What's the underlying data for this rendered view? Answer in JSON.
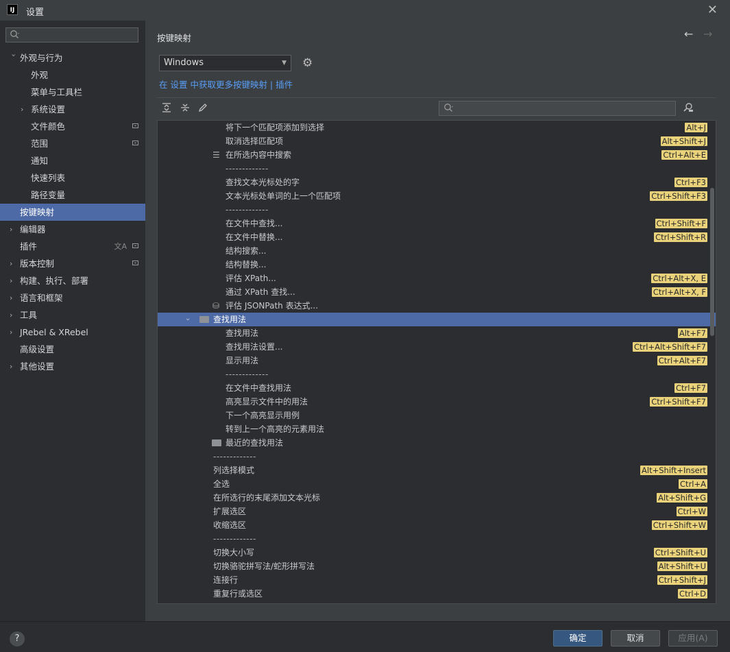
{
  "window": {
    "title": "设置",
    "logo": "IJ"
  },
  "sidebar": {
    "search_placeholder": "",
    "items": [
      {
        "label": "外观与行为",
        "indent": 1,
        "expanded": true,
        "chevron": true,
        "badge": false
      },
      {
        "label": "外观",
        "indent": 2
      },
      {
        "label": "菜单与工具栏",
        "indent": 2
      },
      {
        "label": "系统设置",
        "indent": 2,
        "chevron": true
      },
      {
        "label": "文件颜色",
        "indent": 2,
        "badge": true
      },
      {
        "label": "范围",
        "indent": 2,
        "badge": true
      },
      {
        "label": "通知",
        "indent": 2
      },
      {
        "label": "快速列表",
        "indent": 2
      },
      {
        "label": "路径变量",
        "indent": 2
      },
      {
        "label": "按键映射",
        "indent": 1,
        "selected": true
      },
      {
        "label": "编辑器",
        "indent": 1,
        "chevron": true
      },
      {
        "label": "插件",
        "indent": 1,
        "badge": true,
        "lang": true
      },
      {
        "label": "版本控制",
        "indent": 1,
        "chevron": true,
        "badge": true
      },
      {
        "label": "构建、执行、部署",
        "indent": 1,
        "chevron": true
      },
      {
        "label": "语言和框架",
        "indent": 1,
        "chevron": true
      },
      {
        "label": "工具",
        "indent": 1,
        "chevron": true
      },
      {
        "label": "JRebel & XRebel",
        "indent": 1,
        "chevron": true
      },
      {
        "label": "高级设置",
        "indent": 1
      },
      {
        "label": "其他设置",
        "indent": 1,
        "chevron": true
      }
    ]
  },
  "header": {
    "title": "按键映射"
  },
  "keymap": {
    "selected": "Windows",
    "link_prefix": "在 设置 中获取更多按键映射",
    "link_sep": " | ",
    "link_plugins": "插件"
  },
  "filter": {
    "placeholder": ""
  },
  "actions": [
    {
      "label": "将下一个匹配项添加到选择",
      "indent": 2,
      "shortcut": "Alt+J"
    },
    {
      "label": "取消选择匹配项",
      "indent": 2,
      "shortcut": "Alt+Shift+J"
    },
    {
      "label": "在所选内容中搜索",
      "indent": 2,
      "shortcut": "Ctrl+Alt+E",
      "icon": "search-in-selection-icon"
    },
    {
      "label": "-------------",
      "indent": 2,
      "sep": true
    },
    {
      "label": "查找文本光标处的字",
      "indent": 2,
      "shortcut": "Ctrl+F3"
    },
    {
      "label": "文本光标处单词的上一个匹配项",
      "indent": 2,
      "shortcut": "Ctrl+Shift+F3"
    },
    {
      "label": "-------------",
      "indent": 2,
      "sep": true
    },
    {
      "label": "在文件中查找...",
      "indent": 2,
      "shortcut": "Ctrl+Shift+F"
    },
    {
      "label": "在文件中替换...",
      "indent": 2,
      "shortcut": "Ctrl+Shift+R"
    },
    {
      "label": "结构搜索...",
      "indent": 2
    },
    {
      "label": "结构替换...",
      "indent": 2
    },
    {
      "label": "评估 XPath...",
      "indent": 2,
      "shortcut": "Ctrl+Alt+X, E"
    },
    {
      "label": "通过 XPath 查找...",
      "indent": 2,
      "shortcut": "Ctrl+Alt+X, F"
    },
    {
      "label": "评估 JSONPath 表达式...",
      "indent": 2,
      "icon": "jsonpath-icon"
    },
    {
      "label": "查找用法",
      "indent": 1,
      "group": true,
      "selected": true
    },
    {
      "label": "查找用法",
      "indent": 2,
      "shortcut": "Alt+F7"
    },
    {
      "label": "查找用法设置...",
      "indent": 2,
      "shortcut": "Ctrl+Alt+Shift+F7"
    },
    {
      "label": "显示用法",
      "indent": 2,
      "shortcut": "Ctrl+Alt+F7"
    },
    {
      "label": "-------------",
      "indent": 2,
      "sep": true
    },
    {
      "label": "在文件中查找用法",
      "indent": 2,
      "shortcut": "Ctrl+F7"
    },
    {
      "label": "高亮显示文件中的用法",
      "indent": 2,
      "shortcut": "Ctrl+Shift+F7"
    },
    {
      "label": "下一个高亮显示用例",
      "indent": 2
    },
    {
      "label": "转到上一个高亮的元素用法",
      "indent": 2
    },
    {
      "label": "最近的查找用法",
      "indent": 2,
      "folder": true
    },
    {
      "label": "-------------",
      "indent": 1,
      "sep": true
    },
    {
      "label": "列选择模式",
      "indent": 1,
      "shortcut": "Alt+Shift+Insert"
    },
    {
      "label": "全选",
      "indent": 1,
      "shortcut": "Ctrl+A"
    },
    {
      "label": "在所选行的末尾添加文本光标",
      "indent": 1,
      "shortcut": "Alt+Shift+G"
    },
    {
      "label": "扩展选区",
      "indent": 1,
      "shortcut": "Ctrl+W"
    },
    {
      "label": "收缩选区",
      "indent": 1,
      "shortcut": "Ctrl+Shift+W"
    },
    {
      "label": "-------------",
      "indent": 1,
      "sep": true
    },
    {
      "label": "切换大小写",
      "indent": 1,
      "shortcut": "Ctrl+Shift+U"
    },
    {
      "label": "切换骆驼拼写法/蛇形拼写法",
      "indent": 1,
      "shortcut": "Alt+Shift+U"
    },
    {
      "label": "连接行",
      "indent": 1,
      "shortcut": "Ctrl+Shift+J"
    },
    {
      "label": "重复行或选区",
      "indent": 1,
      "shortcut": "Ctrl+D"
    }
  ],
  "footer": {
    "help": "?",
    "ok": "确定",
    "cancel": "取消",
    "apply": "应用(A)"
  }
}
